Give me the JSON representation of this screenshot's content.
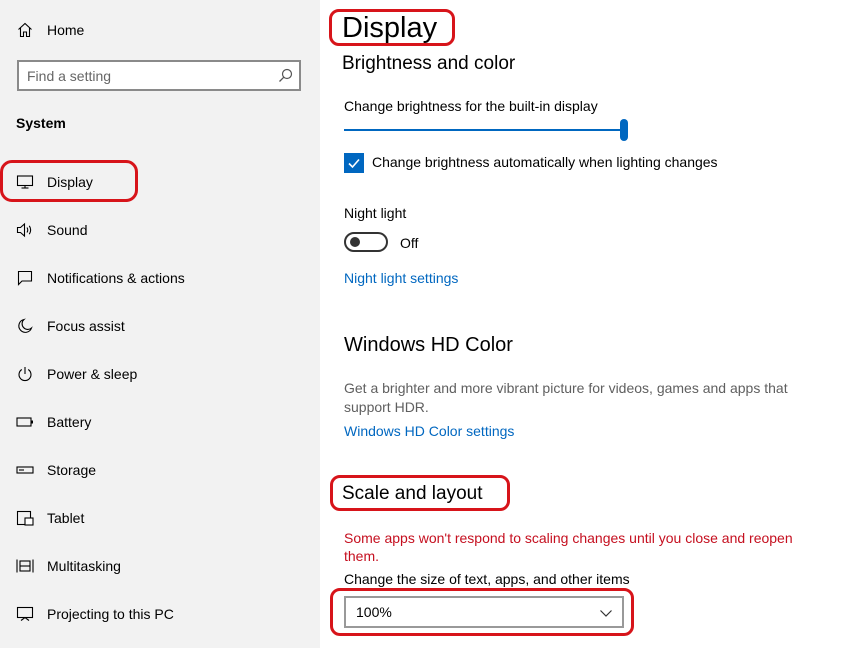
{
  "sidebar": {
    "home_label": "Home",
    "search_placeholder": "Find a setting",
    "section_title": "System",
    "items": [
      {
        "label": "Display",
        "icon": "monitor-icon"
      },
      {
        "label": "Sound",
        "icon": "speaker-icon"
      },
      {
        "label": "Notifications & actions",
        "icon": "notification-icon"
      },
      {
        "label": "Focus assist",
        "icon": "moon-icon"
      },
      {
        "label": "Power & sleep",
        "icon": "power-icon"
      },
      {
        "label": "Battery",
        "icon": "battery-icon"
      },
      {
        "label": "Storage",
        "icon": "storage-icon"
      },
      {
        "label": "Tablet",
        "icon": "tablet-icon"
      },
      {
        "label": "Multitasking",
        "icon": "multitasking-icon"
      },
      {
        "label": "Projecting to this PC",
        "icon": "projecting-icon"
      }
    ]
  },
  "main": {
    "title": "Display",
    "brightness": {
      "heading": "Brightness and color",
      "slider_label": "Change brightness for the built-in display",
      "slider_value_fraction": 1.0,
      "auto_checkbox_label": "Change brightness automatically when lighting changes",
      "auto_checked": true
    },
    "night_light": {
      "label": "Night light",
      "state": "Off",
      "settings_link": "Night light settings"
    },
    "hd_color": {
      "heading": "Windows HD Color",
      "description_line1": "Get a brighter and more vibrant picture for videos, games and apps that",
      "description_line2": "support HDR.",
      "settings_link": "Windows HD Color settings"
    },
    "scale": {
      "heading": "Scale and layout",
      "warning_line1": "Some apps won't respond to scaling changes until you close and reopen",
      "warning_line2": "them.",
      "size_label": "Change the size of text, apps, and other items",
      "size_value": "100%"
    }
  },
  "colors": {
    "accent": "#0067c0",
    "warning": "#c50f1f",
    "highlight_ring": "#d7141a",
    "sidebar_bg": "#f2f2f2"
  }
}
